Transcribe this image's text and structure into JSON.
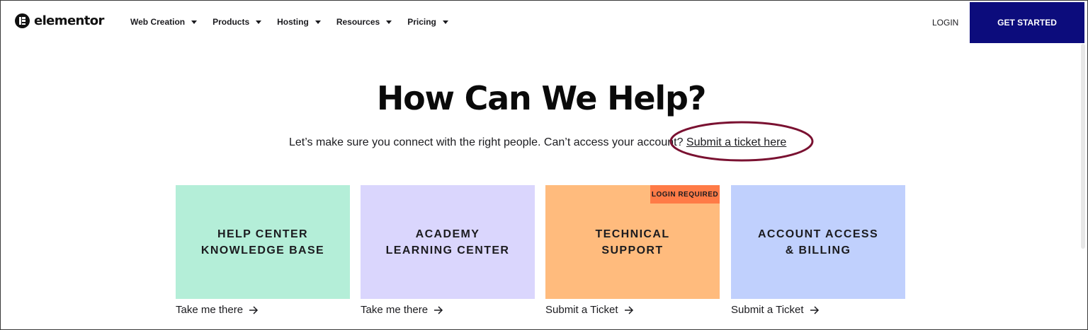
{
  "colors": {
    "brand_dark": "#0c0c7c",
    "card_help": "#b4eed8",
    "card_academy": "#dad6fd",
    "card_support": "#ffbb7d",
    "card_account": "#c0d0fd",
    "badge": "#ff7b47",
    "annotation": "#7a1131"
  },
  "header": {
    "logo_text": "elementor",
    "nav": [
      {
        "label": "Web Creation"
      },
      {
        "label": "Products"
      },
      {
        "label": "Hosting"
      },
      {
        "label": "Resources"
      },
      {
        "label": "Pricing"
      }
    ],
    "login_label": "LOGIN",
    "cta_label": "GET STARTED"
  },
  "hero": {
    "title": "How Can We Help?",
    "subtitle": "Let’s make sure you connect with the right people. Can’t access your account?",
    "subtitle_link": "Submit a ticket here"
  },
  "cards": [
    {
      "line1": "HELP CENTER",
      "line2": "KNOWLEDGE BASE",
      "link": "Take me there"
    },
    {
      "line1": "ACADEMY",
      "line2": "LEARNING CENTER",
      "link": "Take me there"
    },
    {
      "line1": "TECHNICAL",
      "line2": "SUPPORT",
      "link": "Submit a Ticket",
      "badge": "LOGIN REQUIRED"
    },
    {
      "line1": "ACCOUNT ACCESS",
      "line2": "& BILLING",
      "link": "Submit a Ticket"
    }
  ]
}
